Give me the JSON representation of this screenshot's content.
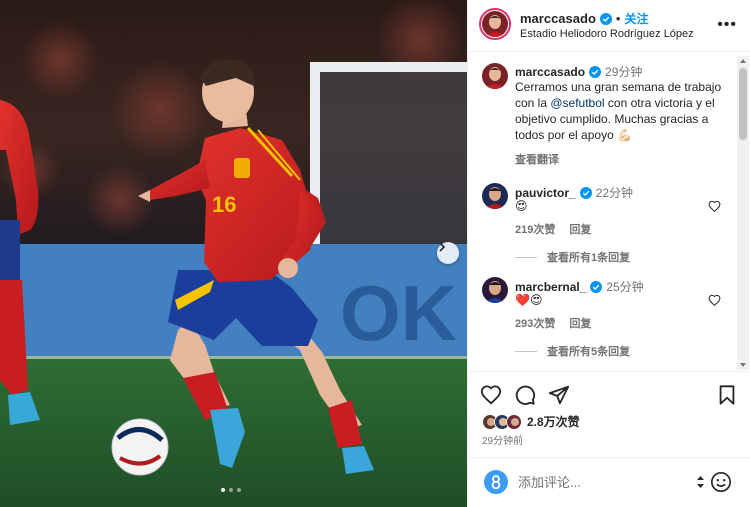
{
  "post": {
    "username": "marccasado",
    "follow_label": "关注",
    "separator": "•",
    "location": "Estadio Heliodoro Rodríguez López",
    "more_label": "•••"
  },
  "photo": {
    "shirt_number": "16",
    "board_text": "OK",
    "carousel_dots": 3,
    "active_dot": 0
  },
  "caption": {
    "username": "marccasado",
    "time": "29分钟",
    "text_before": "Cerramos una gran semana de trabajo con la ",
    "mention": "@sefutbol",
    "text_after": " con otra victoria y el objetivo cumplido. Muchas gracias a todos por el apoyo ",
    "emoji": "💪🏻",
    "see_translation": "查看翻译"
  },
  "comments": [
    {
      "username": "pauvictor_",
      "time": "22分钟",
      "text": "😍",
      "likes": "219次赞",
      "reply_label": "回复",
      "view_replies": "查看所有1条回复"
    },
    {
      "username": "marcbernal_",
      "time": "25分钟",
      "text": "❤️😍",
      "likes": "293次赞",
      "reply_label": "回复",
      "view_replies": "查看所有5条回复"
    }
  ],
  "actions": {
    "likes_count": "2.8万次赞",
    "posted_ago": "29分钟前"
  },
  "add_comment": {
    "placeholder": "添加评论..."
  },
  "colors": {
    "accent": "#0095f6",
    "verified": "#0095f6",
    "like_red": "#ed4956",
    "text": "#262626",
    "muted": "#737373"
  }
}
